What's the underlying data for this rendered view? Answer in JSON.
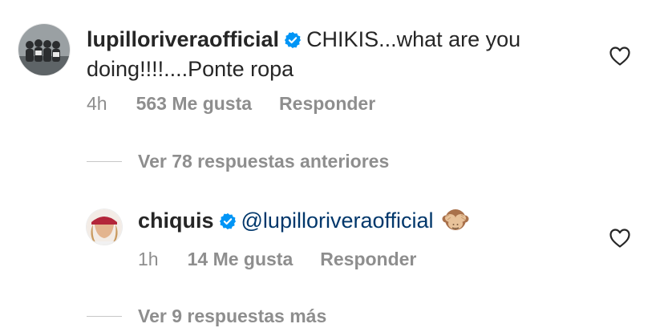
{
  "comments": [
    {
      "username": "lupilloriveraofficial",
      "text_line1": "CHIKIS...what are you",
      "text_line2": "doing!!!!....Ponte ropa",
      "time": "4h",
      "likes": "563 Me gusta",
      "reply_label": "Responder",
      "verified": true
    },
    {
      "username": "chiquis",
      "mention": "@lupilloriveraofficial",
      "emoji": "see-no-evil-monkey",
      "time": "1h",
      "likes": "14 Me gusta",
      "reply_label": "Responder",
      "verified": true
    }
  ],
  "view_previous_replies": "Ver 78 respuestas anteriores",
  "view_more_replies": "Ver 9 respuestas más",
  "colors": {
    "text": "#262626",
    "secondary": "#8e8e8e",
    "mention": "#00376b",
    "verified": "#0095f6"
  }
}
